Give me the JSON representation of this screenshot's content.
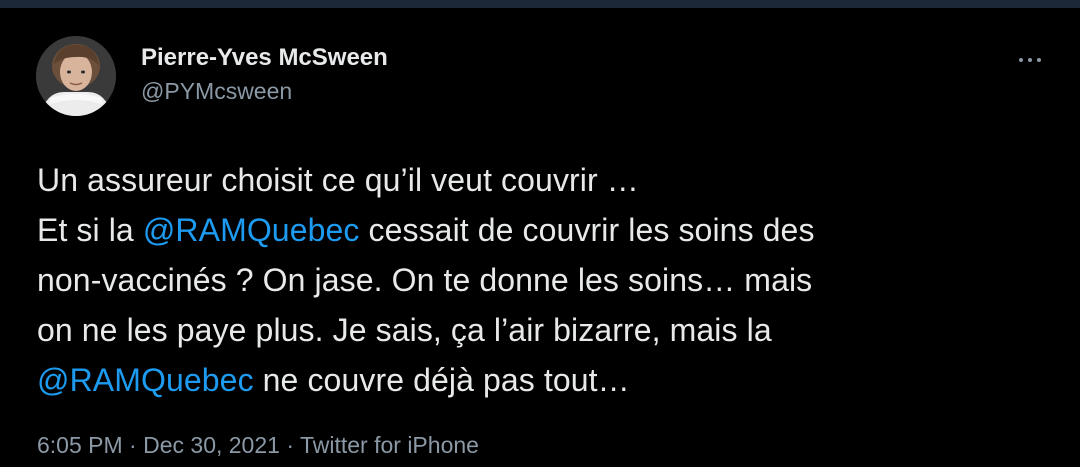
{
  "author": {
    "display_name": "Pierre-Yves McSween",
    "handle": "@PYMcsween"
  },
  "more_icon": "more-horizontal-icon",
  "tweet": {
    "line1": "Un assureur choisit ce qu’il veut couvrir …",
    "line2_prefix": "Et si la ",
    "line2_mention": "@RAMQuebec",
    "line2_suffix": " cessait de couvrir les soins des",
    "line3": "non-vaccinés ?  On jase. On te donne les soins… mais",
    "line4": "on ne les paye plus. Je sais, ça l’air bizarre, mais la",
    "line5_mention": "@RAMQuebec",
    "line5_suffix": " ne couvre déjà pas tout…"
  },
  "meta": {
    "time": "6:05 PM",
    "separator1": " · ",
    "date": "Dec 30, 2021",
    "separator2": " · ",
    "source": "Twitter for iPhone"
  },
  "colors": {
    "background": "#000000",
    "text": "#e7e9ea",
    "secondary": "#8b98a5",
    "link": "#1d9bf0"
  }
}
